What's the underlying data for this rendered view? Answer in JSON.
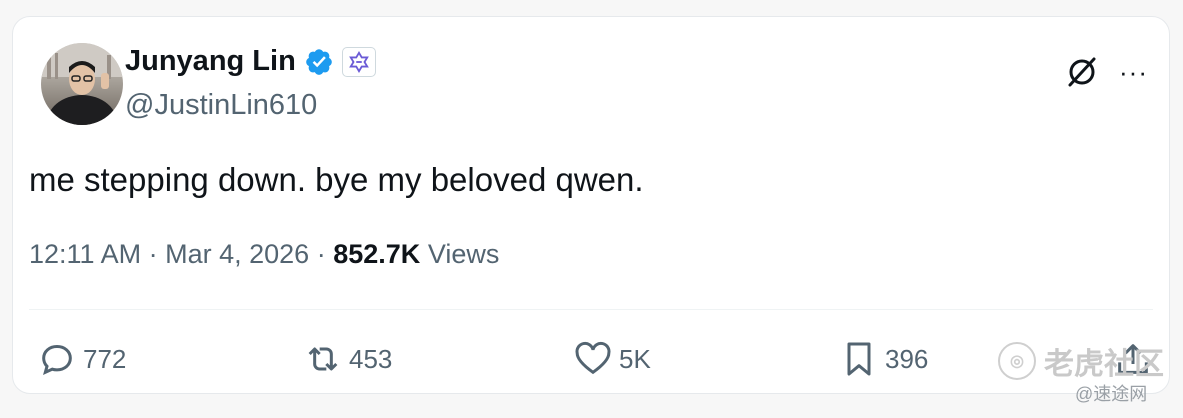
{
  "tweet": {
    "author_name": "Junyang Lin",
    "handle": "@JustinLin610",
    "text": "me stepping down. bye my beloved qwen.",
    "time": "12:11 AM",
    "separator": "·",
    "date": "Mar 4, 2026",
    "views_count": "852.7K",
    "views_label": "Views",
    "more_label": "···"
  },
  "actions": {
    "replies": "772",
    "reposts": "453",
    "likes": "5K",
    "bookmarks": "396"
  },
  "colors": {
    "text_primary": "#0f1419",
    "text_secondary": "#536471",
    "verified_blue": "#1d9bf0",
    "affiliate_purple": "#6b5bd6"
  },
  "watermark": {
    "brand": "老虎社区",
    "source": "@速途网"
  },
  "icons": [
    "verified-badge-icon",
    "affiliate-qwen-icon",
    "grok-icon",
    "more-icon",
    "reply-icon",
    "repost-icon",
    "like-icon",
    "bookmark-icon",
    "share-icon"
  ]
}
